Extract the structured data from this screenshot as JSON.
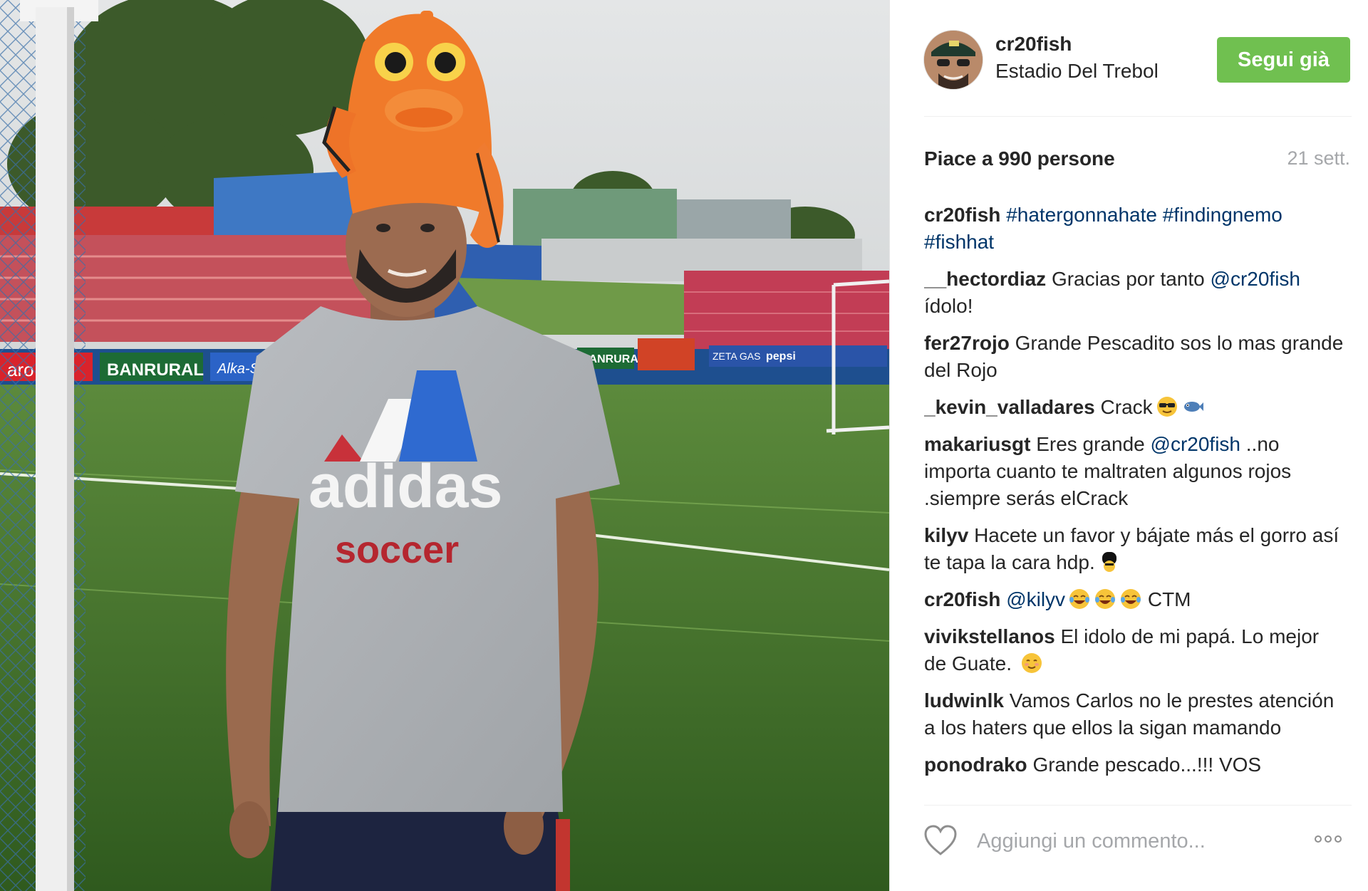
{
  "post": {
    "username": "cr20fish",
    "location": "Estadio Del Trebol",
    "follow_label": "Segui già",
    "likes_text": "Piace a 990 persone",
    "timestamp": "21 sett.",
    "photo": {
      "shirt_brand": "adidas",
      "shirt_text": "soccer",
      "banner_left_1": "aro",
      "banner_left_2": "BANRURAL",
      "banner_left_3": "Alka-Se",
      "banner_mid": "BANRURAL",
      "banner_right_1": "ZETA GAS",
      "banner_right_2": "pepsi"
    }
  },
  "comments": [
    {
      "user": "cr20fish",
      "parts": [
        {
          "t": "link",
          "v": "#hatergonnahate"
        },
        {
          "t": "text",
          "v": " "
        },
        {
          "t": "link",
          "v": "#findingnemo"
        },
        {
          "t": "text",
          "v": " "
        },
        {
          "t": "link",
          "v": "#fishhat"
        }
      ]
    },
    {
      "user": "__hectordiaz",
      "parts": [
        {
          "t": "text",
          "v": "Gracias por tanto "
        },
        {
          "t": "link",
          "v": "@cr20fish"
        },
        {
          "t": "text",
          "v": " ídolo!"
        }
      ]
    },
    {
      "user": "fer27rojo",
      "parts": [
        {
          "t": "text",
          "v": "Grande Pescadito sos lo mas grande del Rojo"
        }
      ]
    },
    {
      "user": "_kevin_valladares",
      "parts": [
        {
          "t": "text",
          "v": "Crack"
        },
        {
          "t": "emoji",
          "v": "sunglasses-emoji"
        },
        {
          "t": "emoji",
          "v": "fish-emoji"
        }
      ]
    },
    {
      "user": "makariusgt",
      "parts": [
        {
          "t": "text",
          "v": "Eres grande "
        },
        {
          "t": "link",
          "v": "@cr20fish"
        },
        {
          "t": "text",
          "v": " ..no importa cuanto te maltraten algunos rojos .siempre serás elCrack"
        }
      ]
    },
    {
      "user": "kilyv",
      "parts": [
        {
          "t": "text",
          "v": "Hacete un favor y bájate más el gorro así te tapa la cara hdp."
        },
        {
          "t": "emoji",
          "v": "guard-emoji"
        }
      ]
    },
    {
      "user": "cr20fish",
      "parts": [
        {
          "t": "link",
          "v": "@kilyv"
        },
        {
          "t": "emoji",
          "v": "joy-emoji"
        },
        {
          "t": "emoji",
          "v": "joy-emoji"
        },
        {
          "t": "emoji",
          "v": "joy-emoji"
        },
        {
          "t": "text",
          "v": " CTM"
        }
      ]
    },
    {
      "user": "vivikstellanos",
      "parts": [
        {
          "t": "text",
          "v": "El idolo de mi papá. Lo mejor de Guate. "
        },
        {
          "t": "emoji",
          "v": "blush-emoji"
        }
      ]
    },
    {
      "user": "ludwinlk",
      "parts": [
        {
          "t": "text",
          "v": "Vamos Carlos no le prestes atención a los haters que ellos la sigan mamando"
        }
      ]
    },
    {
      "user": "ponodrako",
      "parts": [
        {
          "t": "text",
          "v": "Grande pescado...!!! VOS"
        }
      ]
    }
  ],
  "footer": {
    "comment_placeholder": "Aggiungi un commento...",
    "heart_icon": "heart-outline-icon",
    "more_icon": "more-options-icon"
  },
  "colors": {
    "follow_green": "#70c050",
    "link_blue": "#003569",
    "muted_gray": "#a5a7aa"
  }
}
